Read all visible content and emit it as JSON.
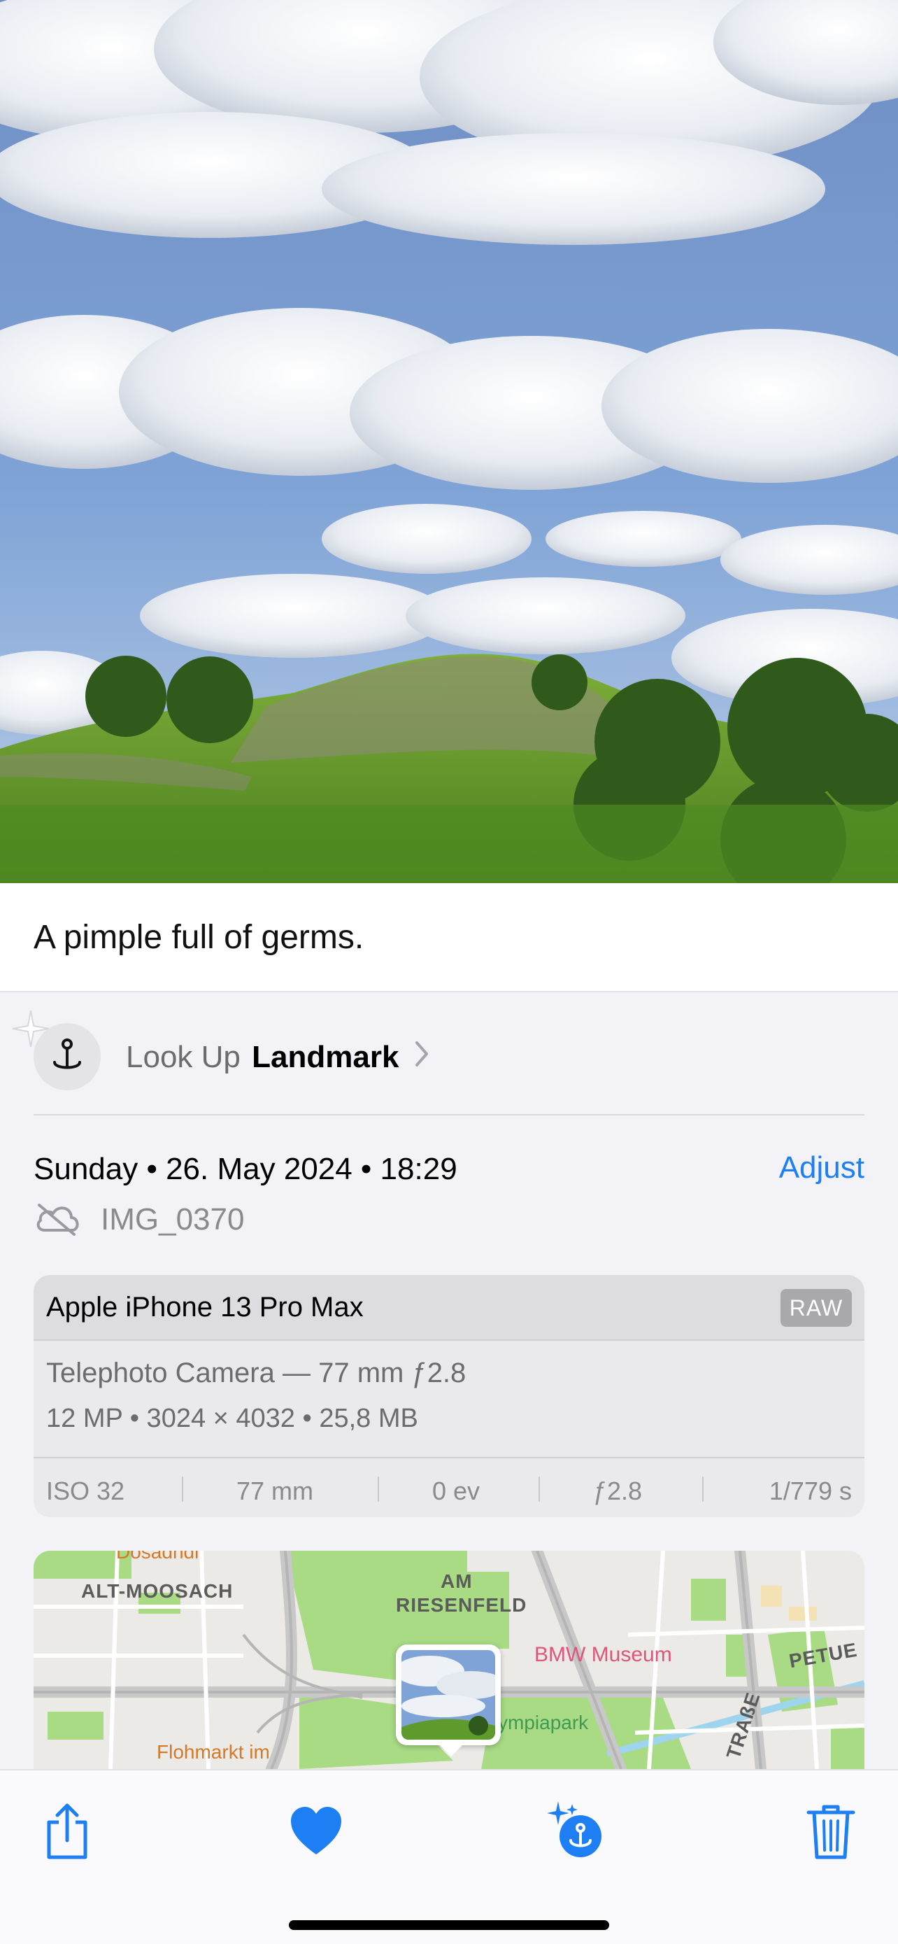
{
  "photo": {
    "description_icon": "photo-image"
  },
  "caption": {
    "text": "A pimple full of germs."
  },
  "lookup": {
    "prefix": "Look Up",
    "subject": "Landmark",
    "icon": "landmark-pin-icon"
  },
  "meta": {
    "date": "Sunday • 26. May 2024 • 18:29",
    "adjust_label": "Adjust",
    "filename": "IMG_0370",
    "cloud_icon": "cloud-slash-icon"
  },
  "camera": {
    "model": "Apple iPhone 13 Pro Max",
    "badge": "RAW",
    "lens": "Telephoto Camera — 77 mm ƒ2.8",
    "specs": "12 MP  •  3024 × 4032  •  25,8 MB",
    "settings": {
      "iso": "ISO 32",
      "focal": "77 mm",
      "ev": "0 ev",
      "aperture": "ƒ2.8",
      "shutter": "1/779 s"
    }
  },
  "map": {
    "labels": {
      "district1": "ALT-MOOSACH",
      "district2_line1": "AM",
      "district2_line2": "RIESENFELD",
      "museum": "BMW Museum",
      "park": "ympiapark",
      "market": "Flohmarkt im",
      "street1": "PETUE",
      "street2": "TRAßE",
      "top_cut": "Dosadhdl"
    }
  },
  "toolbar": {
    "share_icon": "share-icon",
    "favorite_icon": "heart-icon",
    "lookup_icon": "visual-lookup-icon",
    "delete_icon": "trash-icon"
  },
  "colors": {
    "accent": "#1e7ff5",
    "panel": "#f2f2f7"
  }
}
